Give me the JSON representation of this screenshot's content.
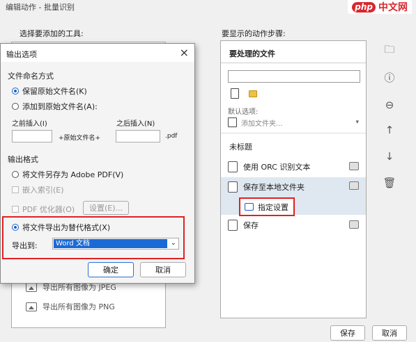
{
  "window": {
    "title": "编辑动作 - 批量识别"
  },
  "watermark": {
    "logo": "php",
    "text": "中文网"
  },
  "left": {
    "label": "选择要添加的工具:",
    "items": [
      {
        "label": "导出所有图像为 JPEG"
      },
      {
        "label": "导出所有图像为 PNG"
      }
    ]
  },
  "right": {
    "label": "要显示的动作步骤:",
    "header": "要处理的文件",
    "input_value": "",
    "default_options_label": "默认选项:",
    "add_folder": "添加文件夹...",
    "untitled": "未标题",
    "steps": [
      {
        "label": "使用 ORC 识别文本"
      },
      {
        "label": "保存至本地文件夹"
      },
      {
        "label": "指定设置"
      },
      {
        "label": "保存"
      }
    ]
  },
  "side_buttons": [
    "add-folder-icon",
    "add-info-icon",
    "remove-icon",
    "arrow-up-icon",
    "arrow-down-icon",
    "trash-icon"
  ],
  "buttons": {
    "save": "保存",
    "cancel": "取消"
  },
  "dialog": {
    "title": "输出选项",
    "close": "×",
    "naming_group": "文件命名方式",
    "keep_name": "保留原始文件名(K)",
    "add_to_name": "添加到原始文件名(A):",
    "insert_before": "之前插入(I)",
    "insert_after": "之后插入(N)",
    "original_name_token": "+原始文件名+",
    "ext": ".pdf",
    "format_group": "输出格式",
    "save_as_pdf": "将文件另存为 Adobe PDF(V)",
    "embed_index": "嵌入索引(E)",
    "pdf_optimizer": "PDF 优化器(O)",
    "settings": "设置(E)...",
    "export_alt": "将文件导出为替代格式(X)",
    "export_to": "导出到:",
    "export_value": "Word 文档",
    "ok": "确定",
    "cancel": "取消"
  },
  "colors": {
    "accent": "#1a6ad6",
    "highlight": "#e02020",
    "selected_row": "#dfe7f0"
  }
}
